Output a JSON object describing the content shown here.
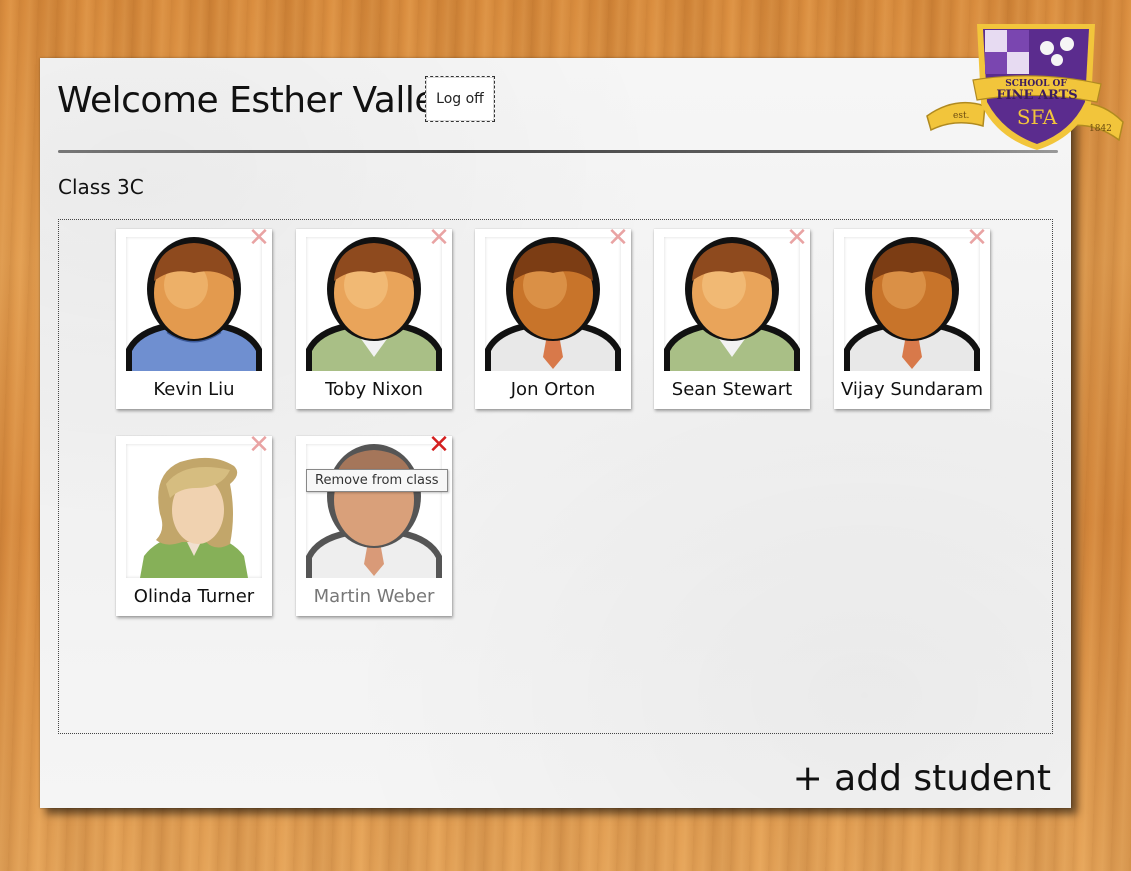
{
  "header": {
    "welcome": "Welcome Esther Valle!",
    "logoff_label": "Log off"
  },
  "crest": {
    "line1": "SCHOOL OF",
    "line2": "FINE ARTS",
    "monogram": "SFA",
    "est_label": "est.",
    "year": "1842",
    "primary_color": "#5b2c8e",
    "gold_color": "#f2c53b"
  },
  "class": {
    "title": "Class 3C"
  },
  "students": [
    {
      "name": "Kevin Liu",
      "avatar": "male-sweater-icon"
    },
    {
      "name": "Toby Nixon",
      "avatar": "male-cardigan-icon"
    },
    {
      "name": "Jon Orton",
      "avatar": "male-shirt-tie-icon"
    },
    {
      "name": "Sean Stewart",
      "avatar": "male-cardigan-icon"
    },
    {
      "name": "Vijay Sundaram",
      "avatar": "male-shirt-tie-icon"
    },
    {
      "name": "Olinda Turner",
      "avatar": "female-icon"
    },
    {
      "name": "Martin Weber",
      "avatar": "male-shirt-tie-icon"
    }
  ],
  "tooltip": "Remove from class",
  "remove_glyph": "✕",
  "add_student_label": "+ add student"
}
